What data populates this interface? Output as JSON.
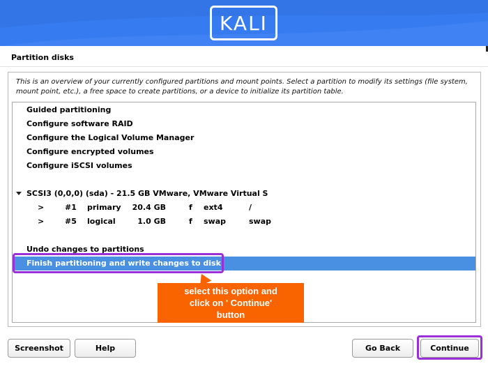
{
  "header": {
    "logo_text": "KALI",
    "brand_color": "#367bf0"
  },
  "page": {
    "title": "Partition disks",
    "description": "This is an overview of your currently configured partitions and mount points. Select a partition to modify its settings (file system, mount point, etc.), a free space to create partitions, or a device to initialize its partition table."
  },
  "list": {
    "items": [
      "Guided partitioning",
      "Configure software RAID",
      "Configure the Logical Volume Manager",
      "Configure encrypted volumes",
      "Configure iSCSI volumes"
    ],
    "disk": "SCSI3 (0,0,0) (sda) - 21.5 GB VMware, VMware Virtual S",
    "partitions": [
      {
        "marker": ">",
        "num": "#1",
        "type": "primary",
        "size": "20.4 GB",
        "flag": "f",
        "fs": "ext4",
        "mount": "/"
      },
      {
        "marker": ">",
        "num": "#5",
        "type": "logical",
        "size": "1.0 GB",
        "flag": "f",
        "fs": "swap",
        "mount": "swap"
      }
    ],
    "undo": "Undo changes to partitions",
    "finish": "Finish partitioning and write changes to disk"
  },
  "annotation": {
    "callout_lines": [
      "select this option and",
      "click on ' Continue'",
      "button"
    ],
    "highlight_color": "#9b30d9",
    "callout_color": "#fa6400"
  },
  "buttons": {
    "screenshot": "Screenshot",
    "help": "Help",
    "go_back": "Go Back",
    "continue": "Continue"
  }
}
